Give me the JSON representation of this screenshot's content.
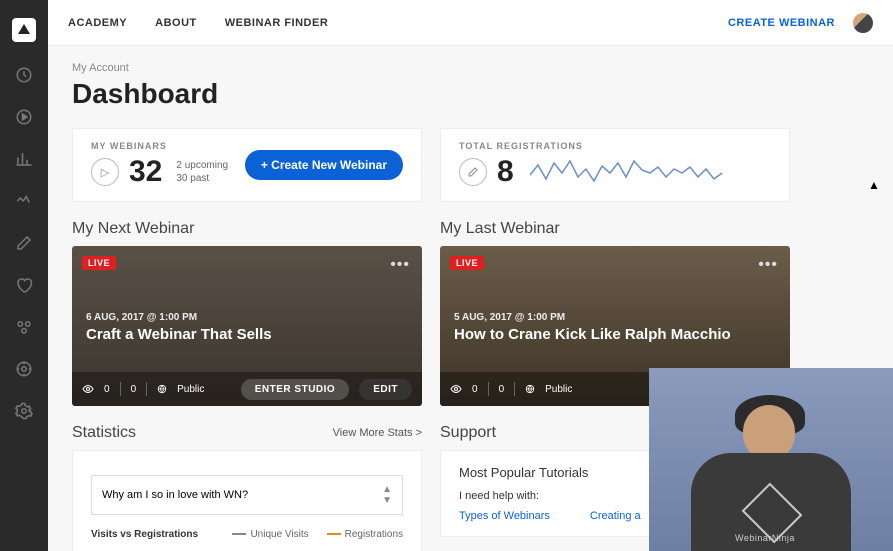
{
  "topnav": {
    "items": [
      "ACADEMY",
      "ABOUT",
      "WEBINAR FINDER"
    ],
    "create": "CREATE WEBINAR"
  },
  "breadcrumb": "My Account",
  "page_title": "Dashboard",
  "my_webinars": {
    "label": "MY WEBINARS",
    "count": "32",
    "upcoming": "2 upcoming",
    "past": "30 past",
    "button": "+ Create New Webinar"
  },
  "total_regs": {
    "label": "TOTAL REGISTRATIONS",
    "count": "8"
  },
  "next_webinar": {
    "section": "My Next Webinar",
    "badge": "LIVE",
    "date": "6 AUG, 2017 @ 1:00 PM",
    "title": "Craft a Webinar That Sells",
    "bar": {
      "n1": "0",
      "n2": "0",
      "vis": "Public",
      "b1": "ENTER STUDIO",
      "b2": "EDIT"
    }
  },
  "last_webinar": {
    "section": "My Last Webinar",
    "badge": "LIVE",
    "date": "5 AUG, 2017 @ 1:00 PM",
    "title": "How to Crane Kick Like Ralph Macchio",
    "bar": {
      "n1": "0",
      "n2": "0",
      "vis": "Public",
      "b1": "ENTER S"
    }
  },
  "statistics": {
    "section": "Statistics",
    "more": "View More Stats >",
    "select": "Why am I so in love with WN?",
    "legend_title": "Visits vs Registrations",
    "legend_a": "Unique Visits",
    "legend_b": "Registrations"
  },
  "support": {
    "section": "Support",
    "heading": "Most Popular Tutorials",
    "sub": "I need help with:",
    "links": [
      "Types of Webinars",
      "Creating a"
    ]
  },
  "camman": {
    "brand": "WebinarNinja"
  },
  "chart_data": {
    "type": "line",
    "title": "Total Registrations",
    "y_approx": [
      3,
      6,
      2,
      7,
      4,
      8,
      3,
      5,
      2,
      6,
      4,
      7,
      3,
      8,
      5,
      4,
      6,
      3,
      5,
      4,
      6,
      3,
      5,
      2,
      4
    ],
    "ylim": [
      0,
      10
    ]
  }
}
